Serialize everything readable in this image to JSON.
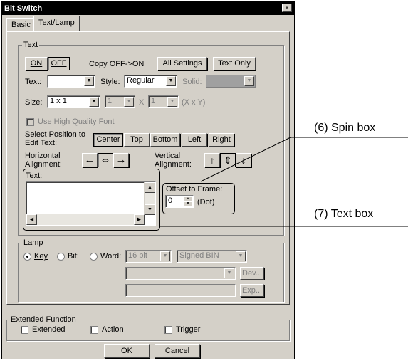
{
  "window": {
    "title": "Bit Switch",
    "close": "×"
  },
  "tabs": [
    {
      "label": "Basic"
    },
    {
      "label": "Text/Lamp"
    }
  ],
  "text_group": {
    "legend": "Text",
    "on_button": "ON",
    "off_button": "OFF",
    "copy_label": "Copy OFF->ON",
    "all_settings_button": "All Settings",
    "text_only_button": "Text Only",
    "text_label": "Text:",
    "text_select_value": "",
    "style_label": "Style:",
    "style_value": "Regular",
    "solid_label": "Solid:",
    "size_label": "Size:",
    "size_value": "1 x 1",
    "size_w": "1",
    "size_x": "X",
    "size_h": "1",
    "size_unit": "(X x Y)",
    "hq_font_label": "Use High Quality Font",
    "select_position_label": "Select Position to Edit Text:",
    "pos_center": "Center",
    "pos_top": "Top",
    "pos_bottom": "Bottom",
    "pos_left": "Left",
    "pos_right": "Right",
    "horiz_align_label": "Horizontal Alignment:",
    "h_left": "←",
    "h_center": "⇔",
    "h_right": "→",
    "vert_align_label": "Vertical Alignment:",
    "v_up": "↑",
    "v_center": "⇕",
    "v_down": "↓",
    "text_box_label": "Text:",
    "text_box_value": "",
    "offset_label": "Offset to Frame:",
    "offset_value": "0",
    "offset_unit": "(Dot)"
  },
  "lamp_group": {
    "legend": "Lamp",
    "key_label": "Key",
    "bit_label": "Bit:",
    "word_label": "Word:",
    "bits_value": "16 bit",
    "format_value": "Signed BIN",
    "dev_button": "Dev...",
    "exp_button": "Exp..."
  },
  "extended_group": {
    "legend": "Extended Function",
    "extended_label": "Extended",
    "action_label": "Action",
    "trigger_label": "Trigger"
  },
  "footer": {
    "ok": "OK",
    "cancel": "Cancel"
  },
  "callouts": {
    "spin_box": "(6) Spin box",
    "text_box": "(7) Text box"
  }
}
